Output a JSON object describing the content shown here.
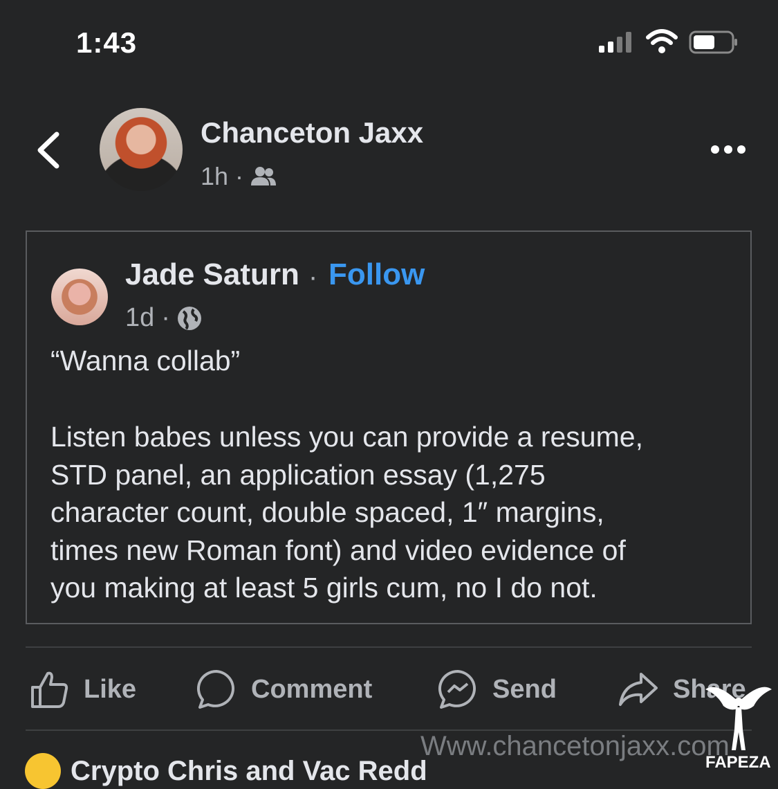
{
  "status": {
    "time": "1:43"
  },
  "post": {
    "author": "Chanceton Jaxx",
    "age": "1h",
    "separator": "·",
    "audience_icon": "friends-icon"
  },
  "shared": {
    "author": "Jade Saturn",
    "separator": "·",
    "follow_label": "Follow",
    "age": "1d",
    "audience_icon": "globe-icon",
    "quote": "“Wanna collab”",
    "lines": [
      "Listen babes unless you can provide a resume,",
      "STD panel, an application essay (1,275",
      "character count, double spaced, 1″ margins,",
      "times new Roman font) and video evidence of",
      "you making at least 5 girls cum, no I do not."
    ]
  },
  "actions": {
    "like": "Like",
    "comment": "Comment",
    "send": "Send",
    "share": "Share"
  },
  "reactions": {
    "names": "Crypto Chris and Vac Redd"
  },
  "watermark": {
    "url": "Www.chancetonjaxx.com",
    "brand": "FAPEZA"
  },
  "colors": {
    "background": "#242526",
    "accent": "#3a97f0",
    "text": "#e4e6eb",
    "muted": "#b0b3b8"
  }
}
